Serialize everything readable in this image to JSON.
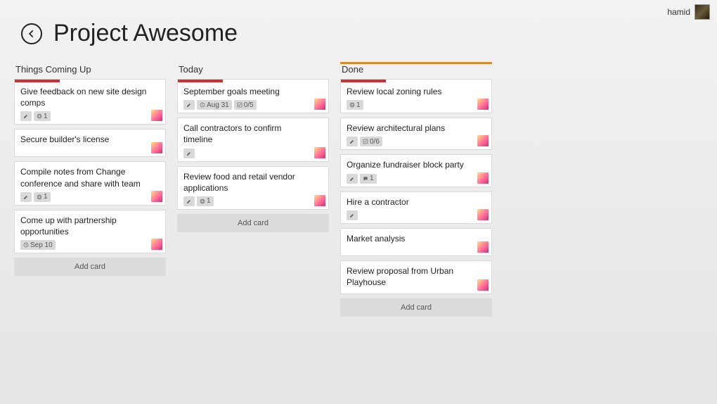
{
  "user": {
    "name": "hamid"
  },
  "board": {
    "title": "Project Awesome"
  },
  "add_card_label": "Add card",
  "lists": [
    {
      "title": "Things Coming Up",
      "cards": [
        {
          "title": "Give feedback on new site design comps",
          "has_desc": true,
          "attachments": "1",
          "member": true,
          "stripe": "red"
        },
        {
          "title": "Secure builder's license",
          "member": true
        },
        {
          "title": "Compile notes from Change conference and share with team",
          "has_desc": true,
          "attachments": "1",
          "member": true
        },
        {
          "title": "Come up with partnership opportunities",
          "due": "Sep 10",
          "member": true
        }
      ]
    },
    {
      "title": "Today",
      "cards": [
        {
          "title": "September goals meeting",
          "has_desc": true,
          "due": "Aug 31",
          "checklist": "0/5",
          "member": true,
          "stripe": "red"
        },
        {
          "title": "Call contractors to confirm timeline",
          "has_desc": true,
          "member": true
        },
        {
          "title": "Review food and retail vendor applications",
          "has_desc": true,
          "attachments": "1",
          "member": true
        }
      ]
    },
    {
      "title": "Done",
      "top_stripe": true,
      "cards": [
        {
          "title": "Review local zoning rules",
          "attachments": "1",
          "member": true,
          "stripe": "red"
        },
        {
          "title": "Review architectural plans",
          "has_desc": true,
          "checklist": "0/6",
          "member": true
        },
        {
          "title": "Organize fundraiser block party",
          "comments": "1",
          "has_desc": true,
          "member": true
        },
        {
          "title": "Hire a contractor",
          "has_desc": true,
          "member": true
        },
        {
          "title": "Market analysis",
          "member": true
        },
        {
          "title": "Review proposal from Urban Playhouse",
          "member": true
        }
      ]
    }
  ]
}
